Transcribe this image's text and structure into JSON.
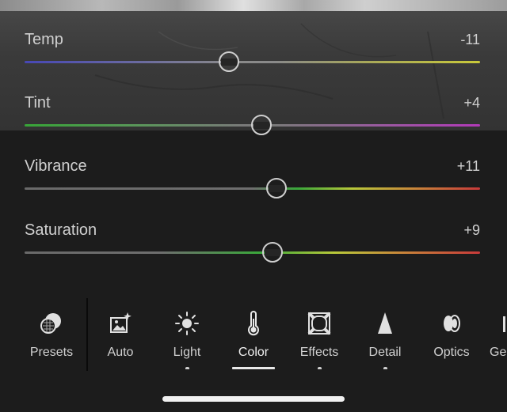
{
  "sliders": [
    {
      "id": "temp",
      "label": "Temp",
      "value": "-11",
      "level": -11
    },
    {
      "id": "tint",
      "label": "Tint",
      "value": "+4",
      "level": 4
    },
    {
      "id": "vibrance",
      "label": "Vibrance",
      "value": "+11",
      "level": 11
    },
    {
      "id": "saturation",
      "label": "Saturation",
      "value": "+9",
      "level": 9
    }
  ],
  "toolbar": {
    "presets": "Presets",
    "auto": "Auto",
    "light": "Light",
    "color": "Color",
    "effects": "Effects",
    "detail": "Detail",
    "optics": "Optics",
    "geometry": "Ge"
  },
  "selected_tool": "color",
  "colors": {
    "temp_left": "#4a4ab8",
    "temp_right": "#c8c83a",
    "tint_left": "#3aa83a",
    "tint_right": "#b03ab8",
    "neutral": "#6e6e6e",
    "sat_gradient": [
      "#3aa83a",
      "#b8c83a",
      "#c87a3a",
      "#c83a3a"
    ]
  }
}
